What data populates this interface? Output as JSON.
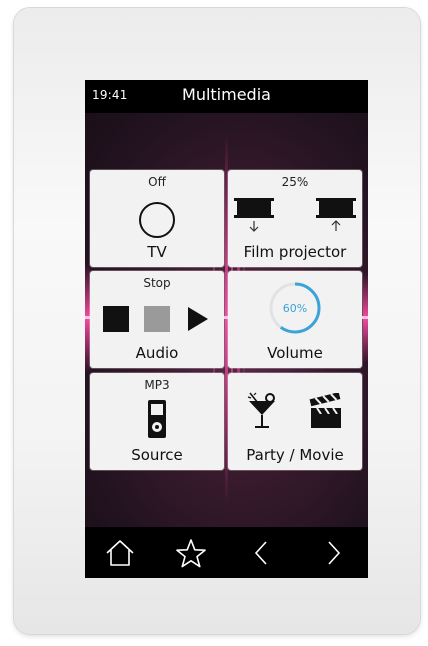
{
  "header": {
    "time": "19:41",
    "title": "Multimedia"
  },
  "tiles": [
    {
      "status": "Off",
      "label": "TV",
      "icon": "circle-icon"
    },
    {
      "status": "25%",
      "label": "Film projector",
      "icon": "projector-screen-icon"
    },
    {
      "status": "Stop",
      "label": "Audio",
      "icons": [
        "stop-icon",
        "pause-icon",
        "play-icon"
      ]
    },
    {
      "status": "",
      "label": "Volume",
      "gauge": {
        "value": 60,
        "text": "60%",
        "color": "#3aa3d8"
      }
    },
    {
      "status": "MP3",
      "label": "Source",
      "icon": "mp3-player-icon"
    },
    {
      "status": "",
      "label": "Party / Movie",
      "icons": [
        "cocktail-icon",
        "clapperboard-icon"
      ]
    }
  ],
  "navbar": {
    "icons": [
      "home-icon",
      "star-icon",
      "chevron-left-icon",
      "chevron-right-icon"
    ]
  },
  "colors": {
    "accent": "#3aa3d8",
    "background": "#2a1624",
    "tile": "#f2f2f2"
  }
}
